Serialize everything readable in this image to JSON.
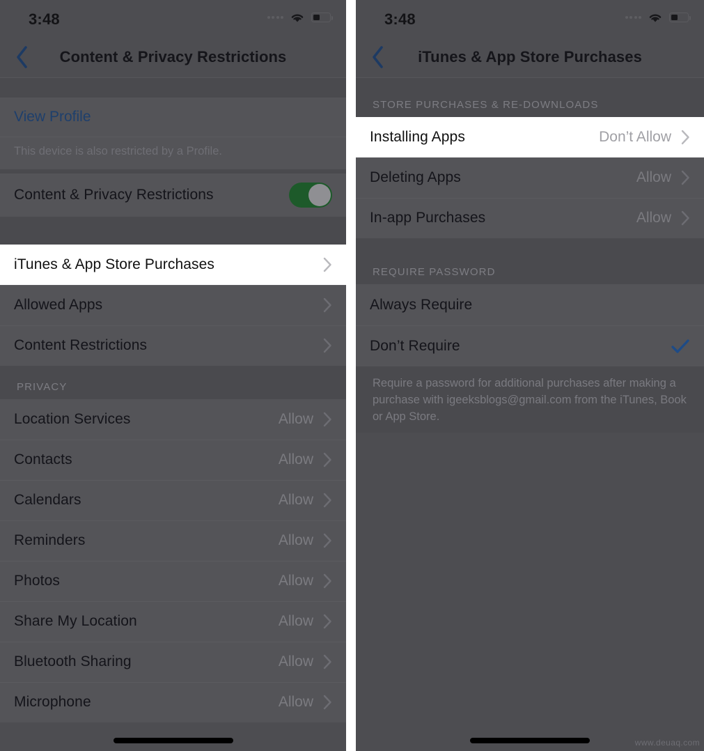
{
  "colors": {
    "dim_background": "#4a4a4e",
    "row_background": "#545458",
    "highlight_background": "#ffffff",
    "accent_blue": "#1e3f6c",
    "toggle_green": "#1d5a2a",
    "secondary_text": "#7b7b80"
  },
  "watermark": "www.deuaq.com",
  "left_screen": {
    "status": {
      "clock": "3:48",
      "signal_icon": "cellular-signal-icon",
      "wifi_icon": "wifi-icon",
      "battery_icon": "battery-low-icon"
    },
    "nav": {
      "back_icon": "chevron-left-icon",
      "title": "Content & Privacy Restrictions"
    },
    "profile_group": {
      "link_label": "View Profile",
      "description": "This device is also restricted by a Profile."
    },
    "master_toggle": {
      "label": "Content & Privacy Restrictions",
      "state": "on"
    },
    "settings_rows": [
      {
        "label": "iTunes & App Store Purchases",
        "value": "",
        "chevron": "chevron-right-icon",
        "highlighted": true
      },
      {
        "label": "Allowed Apps",
        "value": "",
        "chevron": "chevron-right-icon",
        "highlighted": false
      },
      {
        "label": "Content Restrictions",
        "value": "",
        "chevron": "chevron-right-icon",
        "highlighted": false
      }
    ],
    "privacy_section": {
      "header": "PRIVACY",
      "rows": [
        {
          "label": "Location Services",
          "value": "Allow"
        },
        {
          "label": "Contacts",
          "value": "Allow"
        },
        {
          "label": "Calendars",
          "value": "Allow"
        },
        {
          "label": "Reminders",
          "value": "Allow"
        },
        {
          "label": "Photos",
          "value": "Allow"
        },
        {
          "label": "Share My Location",
          "value": "Allow"
        },
        {
          "label": "Bluetooth Sharing",
          "value": "Allow"
        },
        {
          "label": "Microphone",
          "value": "Allow"
        }
      ]
    }
  },
  "right_screen": {
    "status": {
      "clock": "3:48",
      "signal_icon": "cellular-signal-icon",
      "wifi_icon": "wifi-icon",
      "battery_icon": "battery-low-icon"
    },
    "nav": {
      "back_icon": "chevron-left-icon",
      "title": "iTunes & App Store Purchases"
    },
    "store_section": {
      "header": "STORE PURCHASES & RE-DOWNLOADS",
      "rows": [
        {
          "label": "Installing Apps",
          "value": "Don’t Allow",
          "chevron": "chevron-right-icon",
          "highlighted": true
        },
        {
          "label": "Deleting Apps",
          "value": "Allow",
          "chevron": "chevron-right-icon",
          "highlighted": false
        },
        {
          "label": "In-app Purchases",
          "value": "Allow",
          "chevron": "chevron-right-icon",
          "highlighted": false
        }
      ]
    },
    "password_section": {
      "header": "REQUIRE PASSWORD",
      "options": [
        {
          "label": "Always Require",
          "selected": false
        },
        {
          "label": "Don’t Require",
          "selected": true
        }
      ],
      "footnote": "Require a password for additional purchases after making a purchase with igeeksblogs@gmail.com from the iTunes, Book or App Store."
    }
  }
}
